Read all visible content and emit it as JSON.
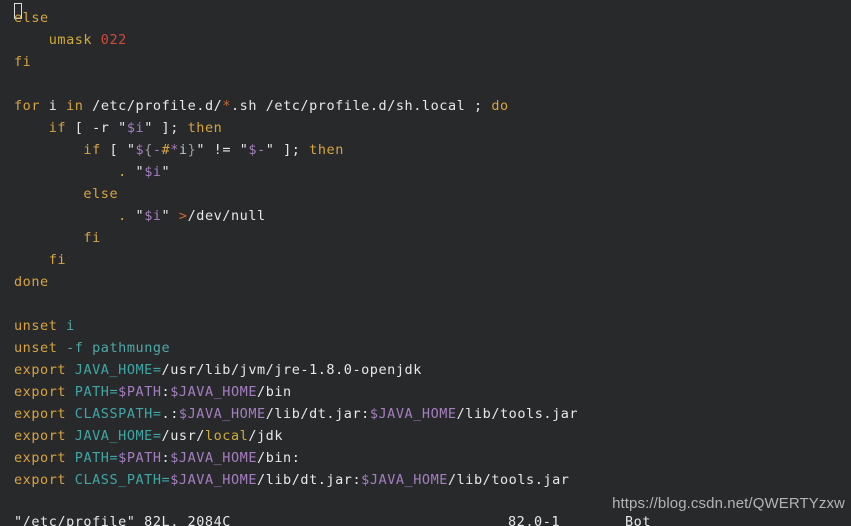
{
  "app": {
    "name": "vim",
    "terminal_background": "#28292b",
    "foreground": "#e8e8e8"
  },
  "palette": {
    "keyword": "#d7a441",
    "text": "#e8e8e8",
    "variable": "#a57ec0",
    "identifier": "#3fa6a6",
    "number": "#d04a3a",
    "operator": "#d06a2a",
    "brace": "#9a9a9a"
  },
  "editor": {
    "filename": "/etc/profile",
    "lines": [
      {
        "n": 1,
        "indent": 0,
        "tokens": [
          {
            "t": "else",
            "c": "kw"
          }
        ]
      },
      {
        "n": 2,
        "indent": 4,
        "tokens": [
          {
            "t": "umask",
            "c": "kw2"
          },
          {
            "t": " ",
            "c": "txt"
          },
          {
            "t": "022",
            "c": "num"
          }
        ]
      },
      {
        "n": 3,
        "indent": 0,
        "tokens": [
          {
            "t": "fi",
            "c": "kw"
          }
        ]
      },
      {
        "n": 4,
        "indent": 0,
        "tokens": []
      },
      {
        "n": 5,
        "indent": 0,
        "tokens": [
          {
            "t": "for",
            "c": "kw"
          },
          {
            "t": " ",
            "c": "txt"
          },
          {
            "t": "i",
            "c": "txt"
          },
          {
            "t": " ",
            "c": "txt"
          },
          {
            "t": "in",
            "c": "kw"
          },
          {
            "t": " /etc/profile.d/",
            "c": "txt"
          },
          {
            "t": "*",
            "c": "op"
          },
          {
            "t": ".sh /etc/profile.d/sh.local ; ",
            "c": "txt"
          },
          {
            "t": "do",
            "c": "kw"
          }
        ]
      },
      {
        "n": 6,
        "indent": 4,
        "tokens": [
          {
            "t": "if",
            "c": "kw"
          },
          {
            "t": " [ ",
            "c": "txt"
          },
          {
            "t": "-r",
            "c": "txt"
          },
          {
            "t": " \"",
            "c": "txt"
          },
          {
            "t": "$i",
            "c": "var"
          },
          {
            "t": "\" ];",
            "c": "txt"
          },
          {
            "t": " ",
            "c": "txt"
          },
          {
            "t": "then",
            "c": "kw"
          }
        ]
      },
      {
        "n": 7,
        "indent": 8,
        "tokens": [
          {
            "t": "if",
            "c": "kw"
          },
          {
            "t": " [ \"",
            "c": "txt"
          },
          {
            "t": "$",
            "c": "var"
          },
          {
            "t": "{",
            "c": "brace"
          },
          {
            "t": "-",
            "c": "var"
          },
          {
            "t": "#",
            "c": "kw"
          },
          {
            "t": "*",
            "c": "var"
          },
          {
            "t": "i",
            "c": "i"
          },
          {
            "t": "}",
            "c": "brace"
          },
          {
            "t": "\" != \"",
            "c": "txt"
          },
          {
            "t": "$-",
            "c": "var"
          },
          {
            "t": "\" ];",
            "c": "txt"
          },
          {
            "t": " ",
            "c": "txt"
          },
          {
            "t": "then",
            "c": "kw"
          }
        ]
      },
      {
        "n": 8,
        "indent": 12,
        "tokens": [
          {
            "t": ".",
            "c": "kw2"
          },
          {
            "t": " \"",
            "c": "txt"
          },
          {
            "t": "$i",
            "c": "var"
          },
          {
            "t": "\"",
            "c": "txt"
          }
        ]
      },
      {
        "n": 9,
        "indent": 8,
        "tokens": [
          {
            "t": "else",
            "c": "kw"
          }
        ]
      },
      {
        "n": 10,
        "indent": 12,
        "tokens": [
          {
            "t": ".",
            "c": "kw2"
          },
          {
            "t": " \"",
            "c": "txt"
          },
          {
            "t": "$i",
            "c": "var"
          },
          {
            "t": "\" ",
            "c": "txt"
          },
          {
            "t": ">",
            "c": "op"
          },
          {
            "t": "/dev/null",
            "c": "txt"
          }
        ]
      },
      {
        "n": 11,
        "indent": 8,
        "tokens": [
          {
            "t": "fi",
            "c": "kw"
          }
        ]
      },
      {
        "n": 12,
        "indent": 4,
        "tokens": [
          {
            "t": "fi",
            "c": "kw"
          }
        ]
      },
      {
        "n": 13,
        "indent": 0,
        "tokens": [
          {
            "t": "done",
            "c": "kw"
          }
        ]
      },
      {
        "n": 14,
        "indent": 0,
        "tokens": []
      },
      {
        "n": 15,
        "indent": 0,
        "tokens": [
          {
            "t": "unset",
            "c": "kw"
          },
          {
            "t": " ",
            "c": "txt"
          },
          {
            "t": "i",
            "c": "flag"
          }
        ]
      },
      {
        "n": 16,
        "indent": 0,
        "tokens": [
          {
            "t": "unset",
            "c": "kw"
          },
          {
            "t": " ",
            "c": "txt"
          },
          {
            "t": "-f",
            "c": "flag"
          },
          {
            "t": " ",
            "c": "txt"
          },
          {
            "t": "pathmunge",
            "c": "flag"
          }
        ]
      },
      {
        "n": 17,
        "indent": 0,
        "tokens": [
          {
            "t": "export",
            "c": "kw"
          },
          {
            "t": " ",
            "c": "txt"
          },
          {
            "t": "JAVA_HOME=",
            "c": "ident"
          },
          {
            "t": "/usr/lib/jvm/jre-1.8.0-openjdk",
            "c": "txt"
          }
        ]
      },
      {
        "n": 18,
        "indent": 0,
        "tokens": [
          {
            "t": "export",
            "c": "kw"
          },
          {
            "t": " ",
            "c": "txt"
          },
          {
            "t": "PATH=",
            "c": "ident"
          },
          {
            "t": "$PATH",
            "c": "var"
          },
          {
            "t": ":",
            "c": "txt"
          },
          {
            "t": "$JAVA_HOME",
            "c": "var"
          },
          {
            "t": "/bin",
            "c": "txt"
          }
        ]
      },
      {
        "n": 19,
        "indent": 0,
        "tokens": [
          {
            "t": "export",
            "c": "kw"
          },
          {
            "t": " ",
            "c": "txt"
          },
          {
            "t": "CLASSPATH=",
            "c": "ident"
          },
          {
            "t": ".:",
            "c": "txt"
          },
          {
            "t": "$JAVA_HOME",
            "c": "var"
          },
          {
            "t": "/lib/dt.jar:",
            "c": "txt"
          },
          {
            "t": "$JAVA_HOME",
            "c": "var"
          },
          {
            "t": "/lib/tools.jar",
            "c": "txt"
          }
        ]
      },
      {
        "n": 20,
        "indent": 0,
        "tokens": [
          {
            "t": "export",
            "c": "kw"
          },
          {
            "t": " ",
            "c": "txt"
          },
          {
            "t": "JAVA_HOME=",
            "c": "ident"
          },
          {
            "t": "/usr/",
            "c": "txt"
          },
          {
            "t": "local",
            "c": "kw2"
          },
          {
            "t": "/jdk",
            "c": "txt"
          }
        ]
      },
      {
        "n": 21,
        "indent": 0,
        "tokens": [
          {
            "t": "export",
            "c": "kw"
          },
          {
            "t": " ",
            "c": "txt"
          },
          {
            "t": "PATH=",
            "c": "ident"
          },
          {
            "t": "$PATH",
            "c": "var"
          },
          {
            "t": ":",
            "c": "txt"
          },
          {
            "t": "$JAVA_HOME",
            "c": "var"
          },
          {
            "t": "/bin:",
            "c": "txt"
          }
        ]
      },
      {
        "n": 22,
        "indent": 0,
        "tokens": [
          {
            "t": "export",
            "c": "kw"
          },
          {
            "t": " ",
            "c": "txt"
          },
          {
            "t": "CLASS_PATH=",
            "c": "ident"
          },
          {
            "t": "$JAVA_HOME",
            "c": "var"
          },
          {
            "t": "/lib/dt.jar:",
            "c": "txt"
          },
          {
            "t": "$JAVA_HOME",
            "c": "var"
          },
          {
            "t": "/lib/tools.jar",
            "c": "txt"
          }
        ]
      }
    ],
    "cursor": {
      "glyph": "block-outline",
      "row": 82,
      "col": 0
    }
  },
  "status": {
    "file": "\"/etc/profile\" 82L, 2084C",
    "position": "82,0-1",
    "scroll": "Bot"
  },
  "watermark": {
    "text": "https://blog.csdn.net/QWERTYzxw"
  }
}
